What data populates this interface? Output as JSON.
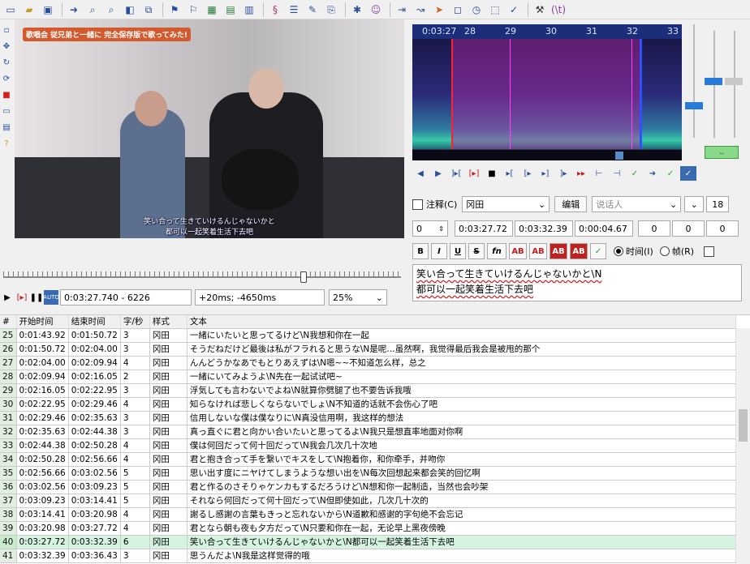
{
  "toolbar": {
    "icons": [
      "new-icon",
      "open-icon",
      "save-icon",
      "jump-icon",
      "zoom-in-icon",
      "zoom-out-icon",
      "snap-icon",
      "attach-icon",
      "keyframe-icon",
      "keyframe-save-icon",
      "grid-icon",
      "style-icon",
      "style-manager-icon",
      "properties-icon",
      "translate-icon",
      "resample-icon",
      "spellcheck-icon",
      "assistant-icon",
      "export-icon",
      "timing-icon",
      "shift-icon",
      "play-icon",
      "stop-icon",
      "clock-icon",
      "resolution-icon",
      "check-icon",
      "tools-icon",
      "automation-icon"
    ]
  },
  "video": {
    "logo": "歌唱会 従兄弟と一緒に 完全保存版で歌ってみた!",
    "subtitle_line1": "笑い合って生きていけるんじゃないかと",
    "subtitle_line2": "都可以一起笑着生活下去吧",
    "time_display": "0:03:27.740 - 6226",
    "offset_display": "+20ms; -4650ms",
    "zoom": "25%"
  },
  "audio": {
    "ruler_time": "0:03:27",
    "ruler_labels": [
      "28",
      "29",
      "30",
      "31",
      "32",
      "33"
    ]
  },
  "edit": {
    "comment_label": "注释(C)",
    "style": "冈田",
    "edit_button": "编辑",
    "actor_placeholder": "说话人",
    "font_size": "18",
    "layer": "0",
    "start": "0:03:27.72",
    "end": "0:03:32.39",
    "duration": "0:00:04.67",
    "margin_l": "0",
    "margin_r": "0",
    "margin_v": "0",
    "format_buttons": [
      "B",
      "I",
      "U",
      "S",
      "fn",
      "AB",
      "AB",
      "AB",
      "AB"
    ],
    "time_radio": "时间(I)",
    "frame_radio": "帧(R)",
    "text_line1": "笑い合って生きていけるんじゃないかと\\N",
    "text_line2": "都可以一起笑着生活下去吧"
  },
  "grid": {
    "headers": [
      "#",
      "开始时间",
      "结束时间",
      "字/秒",
      "样式",
      "文本"
    ],
    "rows": [
      [
        "25",
        "0:01:43.92",
        "0:01:50.72",
        "3",
        "冈田",
        "一緒にいたいと思ってるけど\\N我想和你在一起"
      ],
      [
        "26",
        "0:01:50.72",
        "0:02:04.00",
        "3",
        "冈田",
        "そうだねだけど最後は私がフラれると思うな\\N是呢…虽然啊，我觉得最后我会是被甩的那个"
      ],
      [
        "27",
        "0:02:04.00",
        "0:02:09.94",
        "4",
        "冈田",
        "んんどうかなあでもとりあえずは\\N嗯~~不知道怎么样，总之"
      ],
      [
        "28",
        "0:02:09.94",
        "0:02:16.05",
        "2",
        "冈田",
        "一緒にいてみようよ\\N先在一起试试吧~"
      ],
      [
        "29",
        "0:02:16.05",
        "0:02:22.95",
        "3",
        "冈田",
        "浮気しても言わないでよね\\N就算你劈腿了也不要告诉我哦"
      ],
      [
        "30",
        "0:02:22.95",
        "0:02:29.46",
        "4",
        "冈田",
        "知らなければ悲しくならないでしょ\\N不知道的话就不会伤心了吧"
      ],
      [
        "31",
        "0:02:29.46",
        "0:02:35.63",
        "3",
        "冈田",
        "信用しないな僕は僕なりに\\N真没信用啊，我这样的想法"
      ],
      [
        "32",
        "0:02:35.63",
        "0:02:44.38",
        "3",
        "冈田",
        "真っ直ぐに君と向かい合いたいと思ってるよ\\N我只是想直率地面对你啊"
      ],
      [
        "33",
        "0:02:44.38",
        "0:02:50.28",
        "4",
        "冈田",
        "僕は何回だって何十回だって\\N我会几次几十次地"
      ],
      [
        "34",
        "0:02:50.28",
        "0:02:56.66",
        "4",
        "冈田",
        "君と抱き合って手を繋いでキスをして\\N抱着你，和你牵手，并吻你"
      ],
      [
        "35",
        "0:02:56.66",
        "0:03:02.56",
        "5",
        "冈田",
        "思い出す度にニヤけてしまうような想い出を\\N每次回想起来都会笑的回忆啊"
      ],
      [
        "36",
        "0:03:02.56",
        "0:03:09.23",
        "5",
        "冈田",
        "君と作るのさそりゃケンカもするだろうけど\\N想和你一起制造，当然也会吵架"
      ],
      [
        "37",
        "0:03:09.23",
        "0:03:14.41",
        "5",
        "冈田",
        "それなら何回だって何十回だって\\N但即使如此，几次几十次的"
      ],
      [
        "38",
        "0:03:14.41",
        "0:03:20.98",
        "4",
        "冈田",
        "謝るし感謝の言葉もきっと忘れないから\\N道歉和感谢的字句绝不会忘记"
      ],
      [
        "39",
        "0:03:20.98",
        "0:03:27.72",
        "4",
        "冈田",
        "君となら朝も夜も夕方だって\\N只要和你在一起，无论早上黑夜傍晚"
      ],
      [
        "40",
        "0:03:27.72",
        "0:03:32.39",
        "6",
        "冈田",
        "笑い合って生きていけるんじゃないかと\\N都可以一起笑着生活下去吧"
      ],
      [
        "41",
        "0:03:32.39",
        "0:03:36.43",
        "3",
        "冈田",
        "思うんだよ\\N我是这样觉得的哦"
      ]
    ],
    "active_row": "40"
  }
}
